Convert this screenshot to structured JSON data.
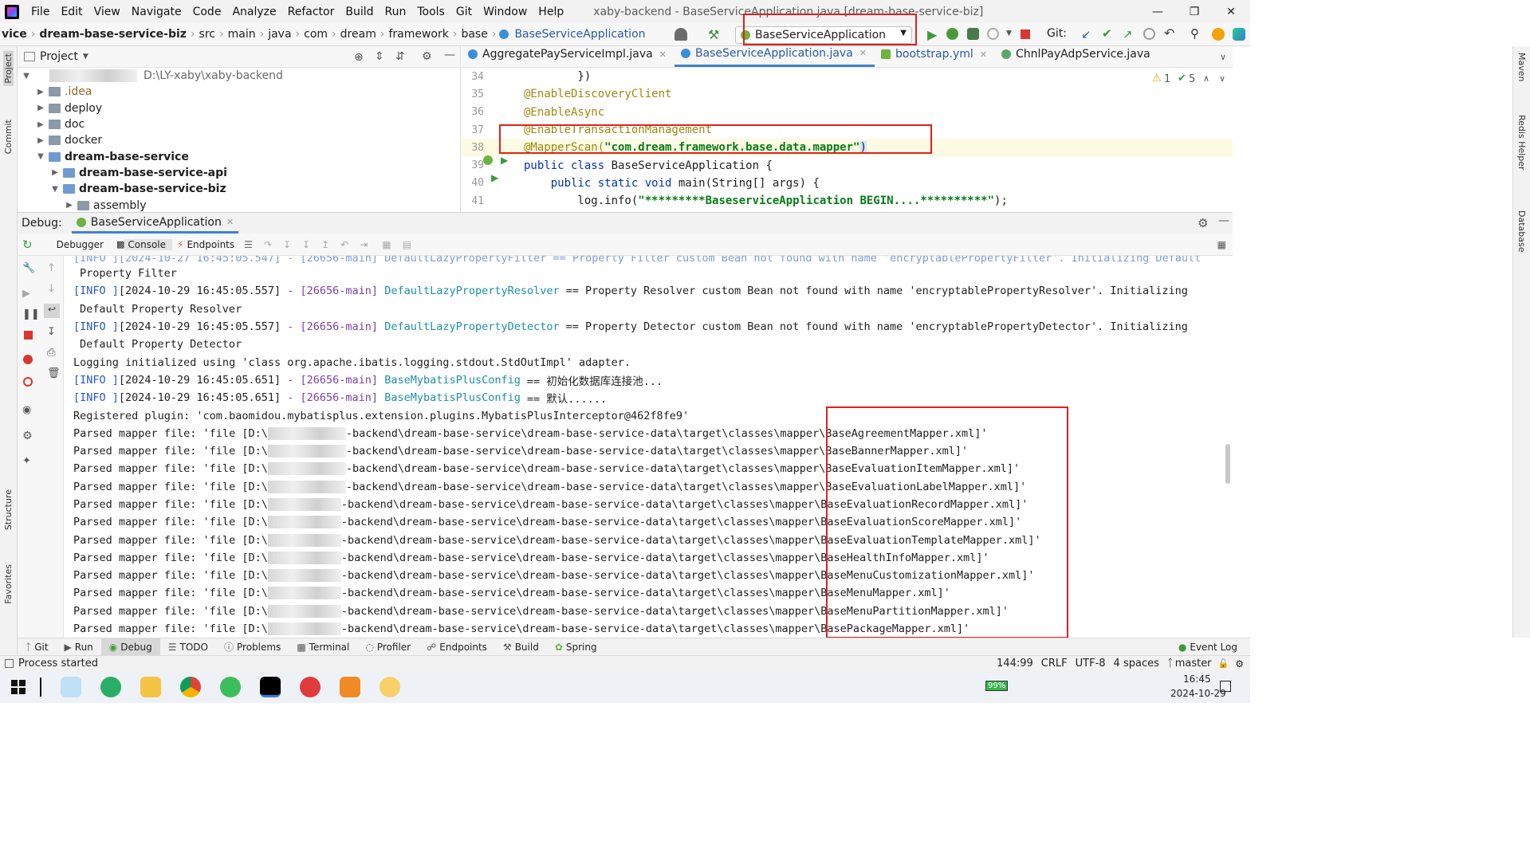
{
  "menubar": {
    "items": [
      "File",
      "Edit",
      "View",
      "Navigate",
      "Code",
      "Analyze",
      "Refactor",
      "Build",
      "Run",
      "Tools",
      "Git",
      "Window",
      "Help"
    ],
    "window_title": "xaby-backend - BaseServiceApplication.java [dream-base-service-biz]"
  },
  "breadcrumb": [
    "vice",
    "dream-base-service-biz",
    "src",
    "main",
    "java",
    "com",
    "dream",
    "framework",
    "base",
    "BaseServiceApplication"
  ],
  "run_config": "BaseServiceApplication",
  "git_label": "Git:",
  "project": {
    "title": "Project",
    "root_path": "D:\\LY-xaby\\xaby-backend",
    "items": [
      {
        "label": ".idea",
        "level": 1
      },
      {
        "label": "deploy",
        "level": 1
      },
      {
        "label": "doc",
        "level": 1
      },
      {
        "label": "docker",
        "level": 1
      },
      {
        "label": "dream-base-service",
        "level": 1
      },
      {
        "label": "dream-base-service-api",
        "level": 2
      },
      {
        "label": "dream-base-service-biz",
        "level": 2
      },
      {
        "label": "assembly",
        "level": 3
      }
    ]
  },
  "editor": {
    "tabs": [
      "AggregatePayServiceImpl.java",
      "BaseServiceApplication.java",
      "bootstrap.yml",
      "ChnlPayAdpService.java"
    ],
    "warnings": "1",
    "checks": "5",
    "lines": [
      {
        "num": "34",
        "text": "        })"
      },
      {
        "num": "35",
        "text": "@EnableDiscoveryClient"
      },
      {
        "num": "36",
        "text": "@EnableAsync"
      },
      {
        "num": "37",
        "text": "@EnableTransactionManagement"
      },
      {
        "num": "38",
        "ann": "@MapperScan(",
        "str": "\"com.dream.framework.base.data.mapper\"",
        "tail": ")"
      },
      {
        "num": "39",
        "kw": "public class ",
        "text": "BaseServiceApplication {"
      },
      {
        "num": "40",
        "kw": "    public static void ",
        "text": "main(String[] args) {"
      },
      {
        "num": "41",
        "pre": "        log.info(",
        "str": "\"*********BaseserviceApplication BEGIN....**********\"",
        "tail": ");"
      }
    ]
  },
  "debug": {
    "label": "Debug:",
    "session": "BaseServiceApplication",
    "tabs": [
      "Debugger",
      "Console",
      "Endpoints"
    ]
  },
  "console": {
    "lines": [
      {
        "type": "cont",
        "text": "Property Filter"
      },
      {
        "type": "log",
        "level": "[INFO ]",
        "ts": "[2024-10-29 16:45:05.557]",
        "thread": "[26656-main]",
        "cls": "DefaultLazyPropertyResolver",
        "msg": "== Property Resolver custom Bean not found with name 'encryptablePropertyResolver'. Initializing"
      },
      {
        "type": "cont",
        "text": "Default Property Resolver"
      },
      {
        "type": "log",
        "level": "[INFO ]",
        "ts": "[2024-10-29 16:45:05.557]",
        "thread": "[26656-main]",
        "cls": "DefaultLazyPropertyDetector",
        "msg": "== Property Detector custom Bean not found with name 'encryptablePropertyDetector'. Initializing"
      },
      {
        "type": "cont",
        "text": "Default Property Detector"
      },
      {
        "type": "plain",
        "text": "Logging initialized using 'class org.apache.ibatis.logging.stdout.StdOutImpl' adapter."
      },
      {
        "type": "log",
        "level": "[INFO ]",
        "ts": "[2024-10-29 16:45:05.651]",
        "thread": "[26656-main]",
        "cls": "BaseMybatisPlusConfig",
        "msg": "== 初始化数据库连接池..."
      },
      {
        "type": "log",
        "level": "[INFO ]",
        "ts": "[2024-10-29 16:45:05.651]",
        "thread": "[26656-main]",
        "cls": "BaseMybatisPlusConfig",
        "msg": "== 默认......"
      },
      {
        "type": "plain",
        "text": "Registered plugin: 'com.baomidou.mybatisplus.extension.plugins.MybatisPlusInterceptor@462f8fe9'"
      }
    ],
    "mapper_prefix": "Parsed mapper file: 'file [D:\\",
    "mapper_mid": "-backend\\dream-base-service\\dream-base-service-data\\target\\classes\\mapper\\",
    "mappers": [
      "BaseAgreementMapper.xml]'",
      "BaseBannerMapper.xml]'",
      "BaseEvaluationItemMapper.xml]'",
      "BaseEvaluationLabelMapper.xml]'",
      "BaseEvaluationRecordMapper.xml]'",
      "BaseEvaluationScoreMapper.xml]'",
      "BaseEvaluationTemplateMapper.xml]'",
      "BaseHealthInfoMapper.xml]'",
      "BaseMenuCustomizationMapper.xml]'",
      "BaseMenuMapper.xml]'",
      "BaseMenuPartitionMapper.xml]'",
      "BasePackageMapper.xml]'"
    ]
  },
  "bottom_tabs": [
    "Git",
    "Run",
    "Debug",
    "TODO",
    "Problems",
    "Terminal",
    "Profiler",
    "Endpoints",
    "Build",
    "Spring"
  ],
  "event_log": "Event Log",
  "status": {
    "message": "Process started",
    "position": "144:99",
    "line_sep": "CRLF",
    "encoding": "UTF-8",
    "indent": "4 spaces",
    "branch": "master"
  },
  "left_stripe": [
    "Project",
    "Commit",
    "Structure",
    "Favorites"
  ],
  "right_stripe": [
    "Maven",
    "Redis Helper",
    "Database"
  ],
  "taskbar": {
    "battery": "99%",
    "time": "16:45",
    "date": "2024-10-29"
  },
  "colors": {
    "highlight_box": "#e02020",
    "accent": "#4083c9"
  }
}
